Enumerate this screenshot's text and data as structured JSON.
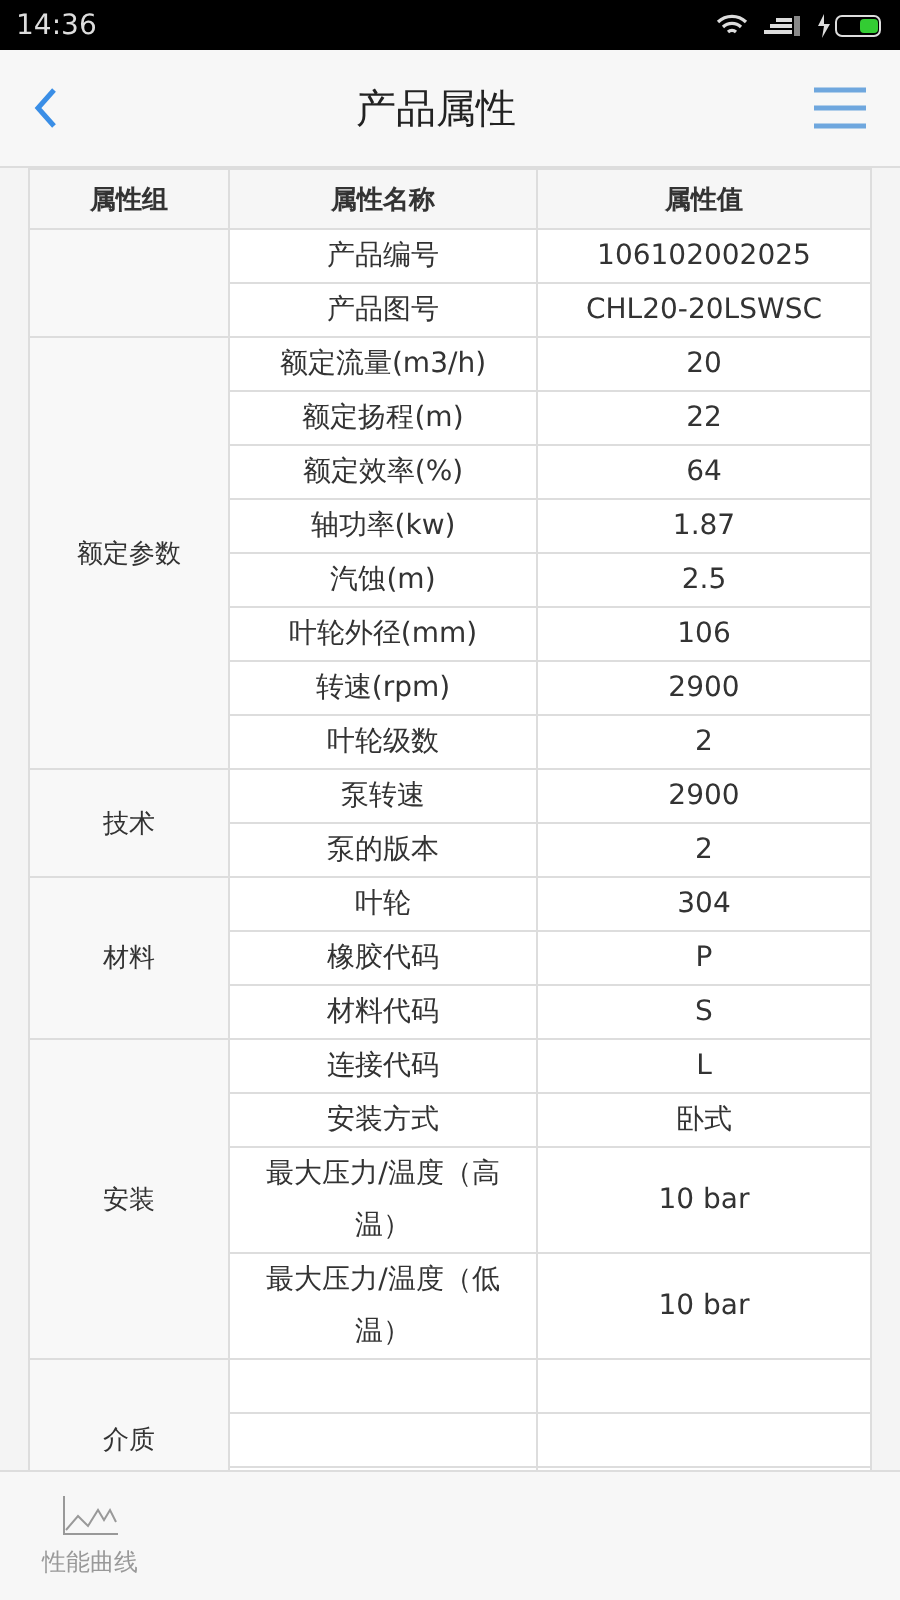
{
  "status_bar": {
    "time": "14:36"
  },
  "header": {
    "title": "产品属性"
  },
  "table": {
    "columns": [
      "属性组",
      "属性名称",
      "属性值"
    ],
    "groups": [
      {
        "rows": [
          {
            "name": "产品编号",
            "value": "106102002025"
          },
          {
            "name": "产品图号",
            "value": "CHL20-20LSWSC"
          }
        ]
      },
      {
        "name": "额定参数",
        "rows": [
          {
            "name": "额定流量(m3/h)",
            "value": "20"
          },
          {
            "name": "额定扬程(m)",
            "value": "22"
          },
          {
            "name": "额定效率(%)",
            "value": "64"
          },
          {
            "name": "轴功率(kw)",
            "value": "1.87"
          },
          {
            "name": "汽蚀(m)",
            "value": "2.5"
          },
          {
            "name": "叶轮外径(mm)",
            "value": "106"
          },
          {
            "name": "转速(rpm)",
            "value": "2900"
          },
          {
            "name": "叶轮级数",
            "value": "2"
          }
        ]
      },
      {
        "name": "技术",
        "rows": [
          {
            "name": "泵转速",
            "value": "2900"
          },
          {
            "name": "泵的版本",
            "value": "2"
          }
        ]
      },
      {
        "name": "材料",
        "rows": [
          {
            "name": "叶轮",
            "value": "304"
          },
          {
            "name": "橡胶代码",
            "value": "P"
          },
          {
            "name": "材料代码",
            "value": "S"
          }
        ]
      },
      {
        "name": "安装",
        "rows": [
          {
            "name": "连接代码",
            "value": "L"
          },
          {
            "name": "安装方式",
            "value": "卧式"
          },
          {
            "name": "最大压力/温度（高温）",
            "value": "10 bar"
          },
          {
            "name": "最大压力/温度（低温）",
            "value": "10 bar"
          }
        ]
      },
      {
        "name": "介质"
      }
    ]
  },
  "tabs": [
    {
      "label": "性能曲线",
      "selected": false
    }
  ]
}
